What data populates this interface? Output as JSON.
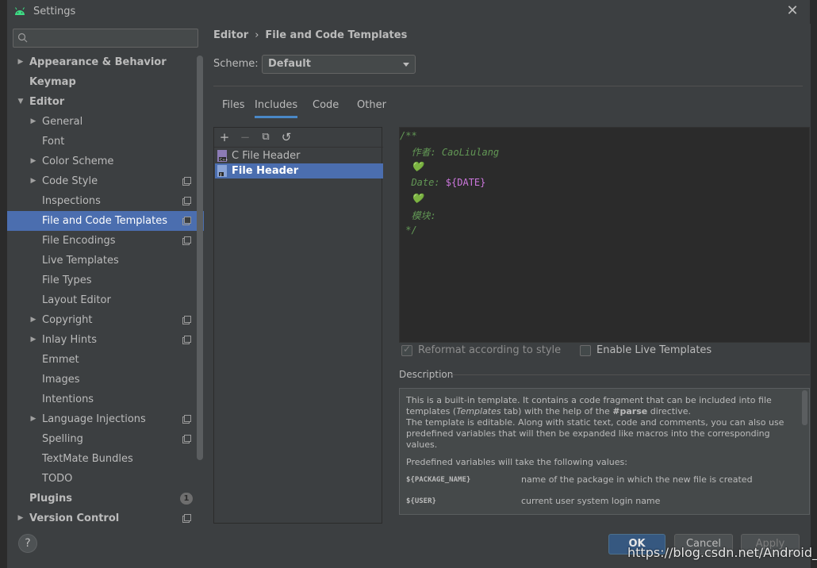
{
  "window": {
    "title": "Settings"
  },
  "search": {
    "value": "",
    "placeholder": ""
  },
  "sidebar": {
    "items": [
      {
        "label": "Appearance & Behavior",
        "bold": true,
        "indent": 0,
        "arrow": "right"
      },
      {
        "label": "Keymap",
        "bold": true,
        "indent": 0,
        "arrow": ""
      },
      {
        "label": "Editor",
        "bold": true,
        "indent": 0,
        "arrow": "down"
      },
      {
        "label": "General",
        "indent": 1,
        "arrow": "right"
      },
      {
        "label": "Font",
        "indent": 1,
        "arrow": ""
      },
      {
        "label": "Color Scheme",
        "indent": 1,
        "arrow": "right"
      },
      {
        "label": "Code Style",
        "indent": 1,
        "arrow": "right",
        "copy": true
      },
      {
        "label": "Inspections",
        "indent": 1,
        "arrow": "",
        "copy": true
      },
      {
        "label": "File and Code Templates",
        "indent": 1,
        "arrow": "",
        "copy": true,
        "selected": true
      },
      {
        "label": "File Encodings",
        "indent": 1,
        "arrow": "",
        "copy": true
      },
      {
        "label": "Live Templates",
        "indent": 1,
        "arrow": ""
      },
      {
        "label": "File Types",
        "indent": 1,
        "arrow": ""
      },
      {
        "label": "Layout Editor",
        "indent": 1,
        "arrow": ""
      },
      {
        "label": "Copyright",
        "indent": 1,
        "arrow": "right",
        "copy": true
      },
      {
        "label": "Inlay Hints",
        "indent": 1,
        "arrow": "right",
        "copy": true
      },
      {
        "label": "Emmet",
        "indent": 1,
        "arrow": ""
      },
      {
        "label": "Images",
        "indent": 1,
        "arrow": ""
      },
      {
        "label": "Intentions",
        "indent": 1,
        "arrow": ""
      },
      {
        "label": "Language Injections",
        "indent": 1,
        "arrow": "right",
        "copy": true
      },
      {
        "label": "Spelling",
        "indent": 1,
        "arrow": "",
        "copy": true
      },
      {
        "label": "TextMate Bundles",
        "indent": 1,
        "arrow": ""
      },
      {
        "label": "TODO",
        "indent": 1,
        "arrow": ""
      },
      {
        "label": "Plugins",
        "bold": true,
        "indent": 0,
        "arrow": "",
        "badge": "1"
      },
      {
        "label": "Version Control",
        "bold": true,
        "indent": 0,
        "arrow": "right",
        "copy": true
      }
    ]
  },
  "breadcrumb": {
    "parent": "Editor",
    "sep": "›",
    "current": "File and Code Templates"
  },
  "scheme": {
    "label": "Scheme:",
    "value": "Default"
  },
  "tabs": [
    {
      "label": "Files"
    },
    {
      "label": "Includes",
      "active": true
    },
    {
      "label": "Code"
    },
    {
      "label": "Other"
    }
  ],
  "toolbar": {
    "add": "+",
    "remove": "−",
    "copy": "⧉",
    "reset": "↺"
  },
  "templates": [
    {
      "label": "C File Header",
      "icon": "c-file-icon"
    },
    {
      "label": "File Header",
      "icon": "java-file-icon",
      "selected": true
    }
  ],
  "editor": {
    "lines": [
      {
        "text": "/**",
        "var": ""
      },
      {
        "text": "  作者: CaoLiulang",
        "var": ""
      },
      {
        "text": "  💚",
        "var": ""
      },
      {
        "text": "  Date: ",
        "var": "${DATE}"
      },
      {
        "text": "  💚",
        "var": ""
      },
      {
        "text": "  模块:",
        "var": ""
      },
      {
        "text": " */",
        "var": ""
      }
    ]
  },
  "options": {
    "reformat": {
      "label": "Reformat according to style",
      "checked": true,
      "disabled": true
    },
    "live_templates": {
      "label": "Enable Live Templates",
      "checked": false
    }
  },
  "description": {
    "label": "Description",
    "p1_a": "This is a built-in template. It contains a code fragment that can be included into file templates (",
    "p1_em": "Templates",
    "p1_b": " tab) with the help of the ",
    "p1_strong": "#parse",
    "p1_c": " directive.",
    "p2": "The template is editable. Along with static text, code and comments, you can also use predefined variables that will then be expanded like macros into the corresponding values.",
    "p3": "Predefined variables will take the following values:",
    "vars": [
      {
        "name": "${PACKAGE_NAME}",
        "desc": "name of the package in which the new file is created"
      },
      {
        "name": "${USER}",
        "desc": "current user system login name"
      }
    ]
  },
  "buttons": {
    "help": "?",
    "ok": "OK",
    "cancel": "Cancel",
    "apply": "Apply"
  },
  "watermark": "https://blog.csdn.net/Android_CII",
  "colors": {
    "accent": "#4b6eaf",
    "comment": "#629755",
    "variable": "#cc77dd"
  }
}
